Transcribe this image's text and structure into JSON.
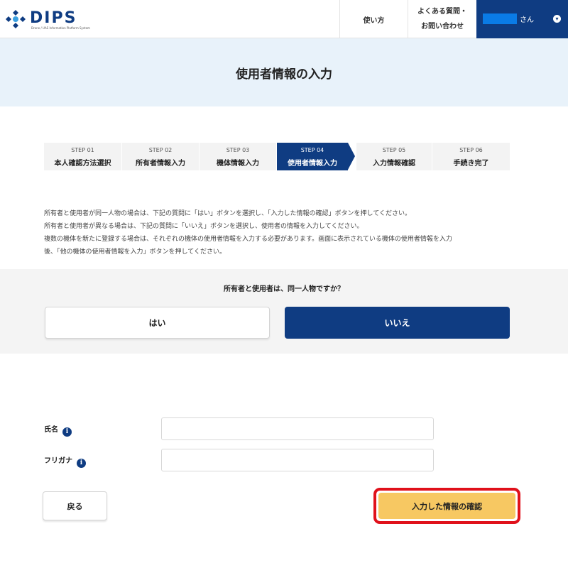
{
  "header": {
    "logo_text": "DIPS",
    "logo_subtitle": "Drone / UAS Information Platform System",
    "nav_usage": "使い方",
    "nav_faq_line1": "よくある質問・",
    "nav_faq_line2": "お問い合わせ",
    "user_suffix": "さん",
    "user_name_color": "#0a7be6"
  },
  "page": {
    "title": "使用者情報の入力"
  },
  "steps": [
    {
      "num": "STEP 01",
      "label": "本人確認方法選択",
      "active": false
    },
    {
      "num": "STEP 02",
      "label": "所有者情報入力",
      "active": false
    },
    {
      "num": "STEP 03",
      "label": "機体情報入力",
      "active": false
    },
    {
      "num": "STEP 04",
      "label": "使用者情報入力",
      "active": true
    },
    {
      "num": "STEP 05",
      "label": "入力情報確認",
      "active": false
    },
    {
      "num": "STEP 06",
      "label": "手続き完了",
      "active": false
    }
  ],
  "instructions": [
    "所有者と使用者が同一人物の場合は、下記の質問に「はい」ボタンを選択し、「入力した情報の確認」ボタンを押してください。",
    "所有者と使用者が異なる場合は、下記の質問に「いいえ」ボタンを選択し、使用者の情報を入力してください。",
    "複数の機体を新たに登録する場合は、それぞれの機体の使用者情報を入力する必要があります。画面に表示されている機体の使用者情報を入力",
    "後、「他の機体の使用者情報を入力」ボタンを押してください。"
  ],
  "question": {
    "text": "所有者と使用者は、同一人物ですか？",
    "yes_label": "はい",
    "no_label": "いいえ",
    "selected": "いいえ"
  },
  "form": {
    "name_label": "氏名",
    "name_value": "",
    "kana_label": "フリガナ",
    "kana_value": "",
    "info_icon": "i"
  },
  "actions": {
    "back_label": "戻る",
    "confirm_label": "入力した情報の確認"
  },
  "colors": {
    "brand": "#0f3c82",
    "title_band": "#e8f2fa",
    "confirm_button": "#f7c862",
    "highlight": "#e0111b"
  }
}
